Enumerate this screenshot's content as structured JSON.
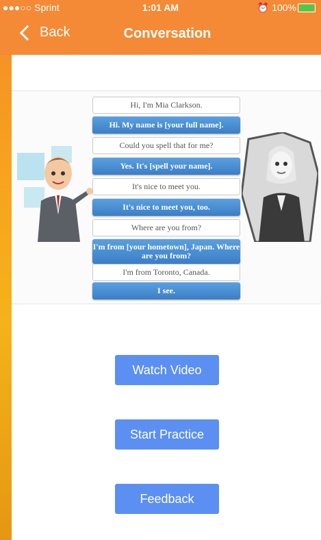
{
  "status_bar": {
    "carrier": "●●●○○ Sprint",
    "time": "1:01 AM",
    "battery": "100%"
  },
  "nav": {
    "back_label": "Back",
    "title": "Conversation"
  },
  "dialogue": [
    {
      "speaker": "woman",
      "text": "Hi, I'm Mia Clarkson."
    },
    {
      "speaker": "man",
      "text": "Hi.  My name is [your full name]."
    },
    {
      "speaker": "woman",
      "text": "Could you spell that for me?"
    },
    {
      "speaker": "man",
      "text": "Yes.  It's [spell your name]."
    },
    {
      "speaker": "woman",
      "text": "It's nice to meet you."
    },
    {
      "speaker": "man",
      "text": "It's nice to meet you, too."
    },
    {
      "speaker": "woman",
      "text": "Where are you from?"
    },
    {
      "speaker": "man",
      "text": "I'm from [your hometown], Japan. Where are you from?"
    },
    {
      "speaker": "woman",
      "text": "I'm from Toronto, Canada."
    },
    {
      "speaker": "man",
      "text": "I see."
    }
  ],
  "buttons": {
    "watch_video": "Watch Video",
    "start_practice": "Start Practice",
    "feedback": "Feedback"
  },
  "colors": {
    "nav_bar": "#f48a35",
    "button": "#5c8ff2",
    "bubble_blue": "#4a8fd6"
  },
  "icons": {
    "back": "chevron-left-icon",
    "wifi": "wifi-icon",
    "location": "location-arrow-icon",
    "alarm": "alarm-icon",
    "battery": "battery-icon"
  }
}
